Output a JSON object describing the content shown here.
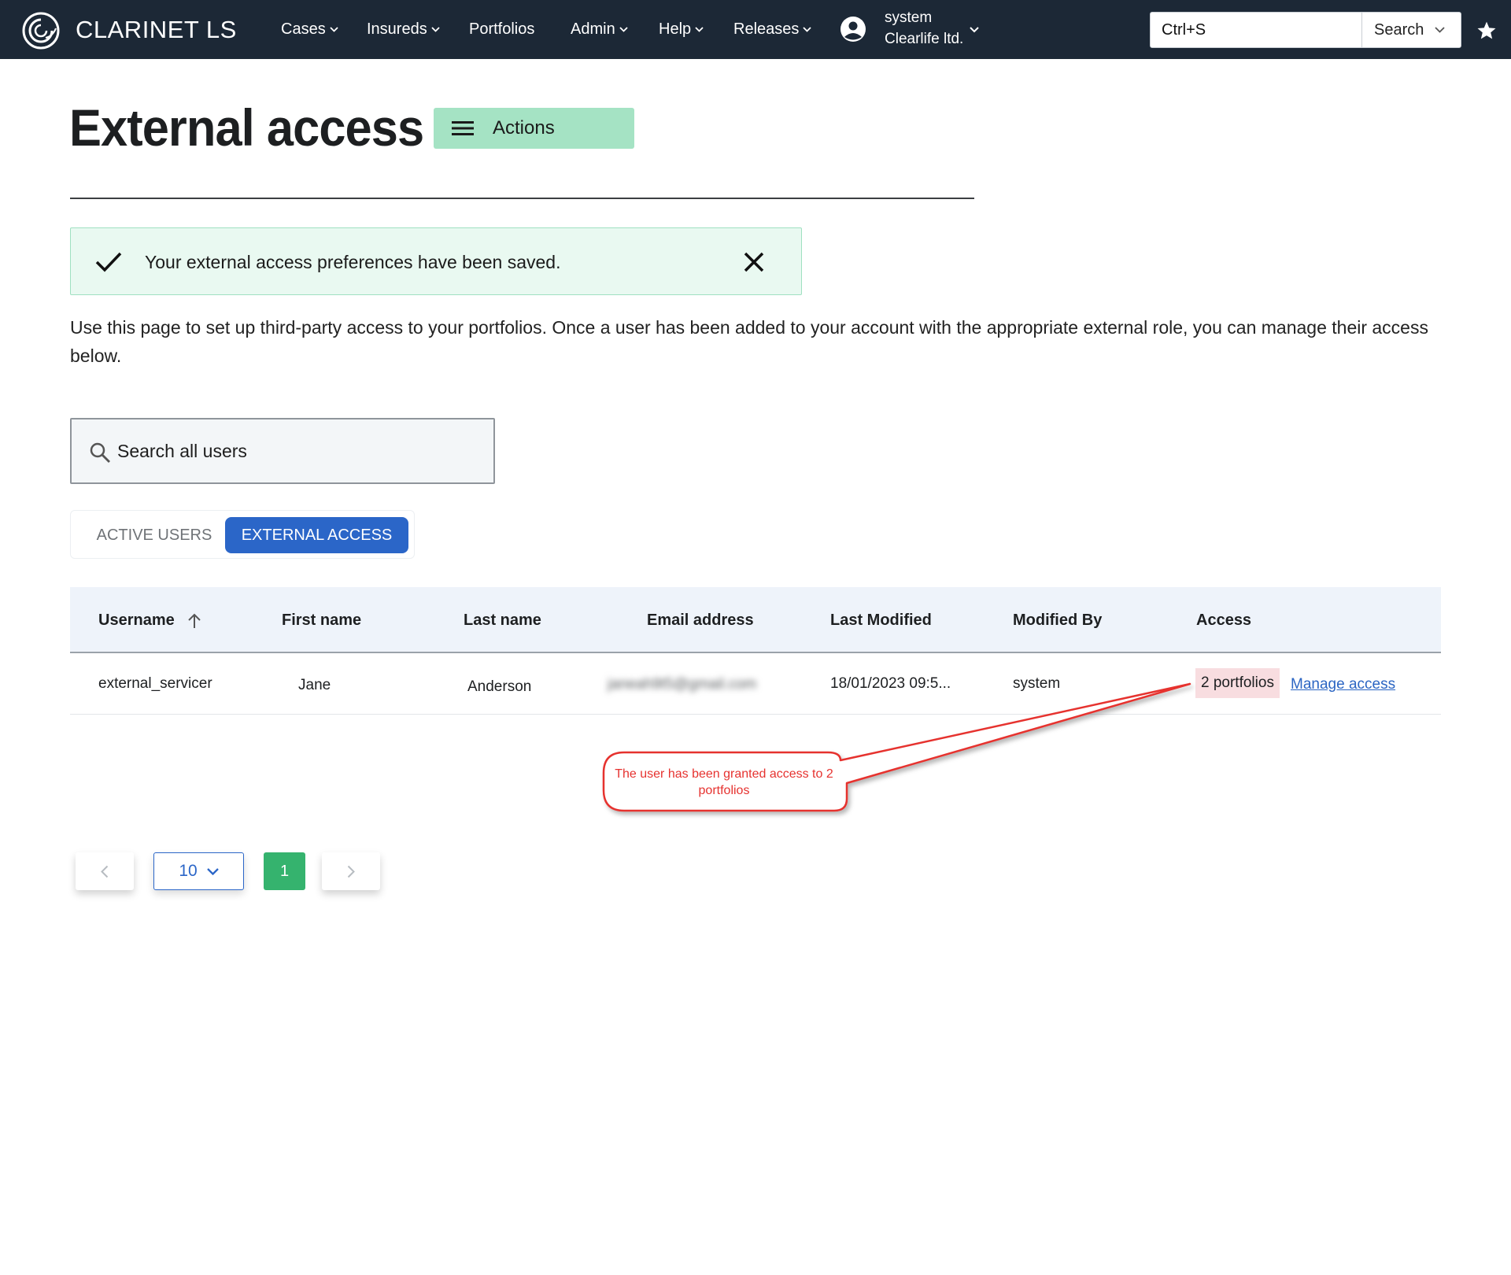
{
  "app": {
    "brand": "CLARINET LS",
    "colors": {
      "topbar": "#1c2836",
      "accent": "#2b66c8",
      "success": "#a5e3c4",
      "page_active": "#35b36e",
      "annotation": "#e6322f"
    }
  },
  "nav": {
    "items": [
      {
        "label": "Cases",
        "has_menu": true
      },
      {
        "label": "Insureds",
        "has_menu": true
      },
      {
        "label": "Portfolios",
        "has_menu": false
      },
      {
        "label": "Admin",
        "has_menu": true
      },
      {
        "label": "Help",
        "has_menu": true
      },
      {
        "label": "Releases",
        "has_menu": true
      }
    ],
    "user": {
      "name": "system",
      "org": "Clearlife ltd.",
      "icon": "account-circle-icon"
    },
    "search": {
      "value": "Ctrl+S",
      "scope_label": "Search"
    },
    "favorite_icon": "star-icon"
  },
  "page": {
    "title": "External access",
    "actions_label": "Actions",
    "alert": "Your external access preferences have been saved.",
    "intro": "Use this page to set up third-party access to your portfolios. Once a user has been added to your account with the appropriate external role, you can manage their access below."
  },
  "user_search": {
    "placeholder": "Search all users"
  },
  "tabs": [
    {
      "label": "ACTIVE USERS",
      "active": false
    },
    {
      "label": "EXTERNAL ACCESS",
      "active": true
    }
  ],
  "table": {
    "columns": [
      "Username",
      "First name",
      "Last name",
      "Email address",
      "Last Modified",
      "Modified By",
      "Access"
    ],
    "sort": {
      "column": "Username",
      "direction": "ascending"
    },
    "rows": [
      {
        "username": "external_servicer",
        "first_name": "Jane",
        "last_name": "Anderson",
        "email": "janeah9t5@gmail.com",
        "last_modified": "18/01/2023 09:5...",
        "modified_by": "system",
        "access": "2 portfolios",
        "manage_label": "Manage access"
      }
    ]
  },
  "annotation": {
    "text": "The user has been granted access to 2 portfolios"
  },
  "pagination": {
    "page_size": "10",
    "current_page": "1"
  }
}
